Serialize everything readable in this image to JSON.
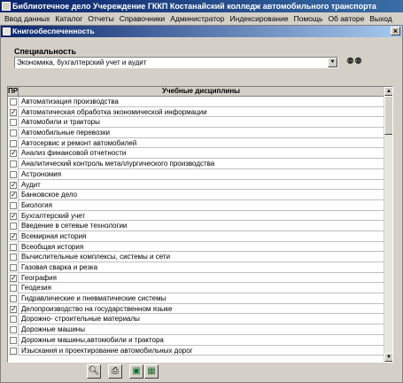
{
  "app": {
    "title": "Библиотечное дело Учереждение ГККП Костанайский колледж автомобильного транспорта"
  },
  "menu": [
    "Ввод данных",
    "Каталог",
    "Отчеты",
    "Справочники",
    "Администратор",
    "Индексирование",
    "Помощь",
    "Об авторе",
    "Выход"
  ],
  "child": {
    "title": "Книгообеспеченность"
  },
  "specialty": {
    "label": "Специальность",
    "value": "Экономика, бухгалтерский учет и аудит"
  },
  "grid": {
    "col_pr": "ПР",
    "col_disc": "Учебные дисциплины",
    "rows": [
      {
        "name": "Автоматизация производства",
        "checked": false
      },
      {
        "name": "Автоматическая обработка экономической информации",
        "checked": true
      },
      {
        "name": "Автомобили и тракторы",
        "checked": false
      },
      {
        "name": "Автомобильные перевозки",
        "checked": false
      },
      {
        "name": "Автосервис и ремонт автомобилей",
        "checked": false
      },
      {
        "name": "Анализ финансовой отчетности",
        "checked": true
      },
      {
        "name": "Аналитический контроль металлургического производства",
        "checked": false
      },
      {
        "name": "Астрономия",
        "checked": false
      },
      {
        "name": "Аудит",
        "checked": true
      },
      {
        "name": "Банковское дело",
        "checked": true
      },
      {
        "name": "Биология",
        "checked": false
      },
      {
        "name": "Бухгалтерский учет",
        "checked": true
      },
      {
        "name": "Введение в сетевые технологии",
        "checked": false
      },
      {
        "name": "Всемирная история",
        "checked": true
      },
      {
        "name": "Всеобщая история",
        "checked": false
      },
      {
        "name": "Вычислительные комплексы, системы и сети",
        "checked": false
      },
      {
        "name": "Газовая сварка и резка",
        "checked": false
      },
      {
        "name": "География",
        "checked": true
      },
      {
        "name": "Геодезия",
        "checked": false
      },
      {
        "name": "Гидравлические и пневматические системы",
        "checked": false
      },
      {
        "name": "Делопроизводство на государственном языке",
        "checked": true
      },
      {
        "name": "Дорожно- строительные материалы",
        "checked": false
      },
      {
        "name": "Дорожные машины",
        "checked": false
      },
      {
        "name": "Дорожные машины,автомобили и трактора",
        "checked": false
      },
      {
        "name": "Изыскания и проектирование автомобильных дорог",
        "checked": false
      }
    ]
  },
  "toolbar": [
    {
      "icon": "preview-icon"
    },
    {
      "icon": "print-icon"
    },
    {
      "icon": "export-icon"
    },
    {
      "icon": "excel-icon"
    }
  ]
}
